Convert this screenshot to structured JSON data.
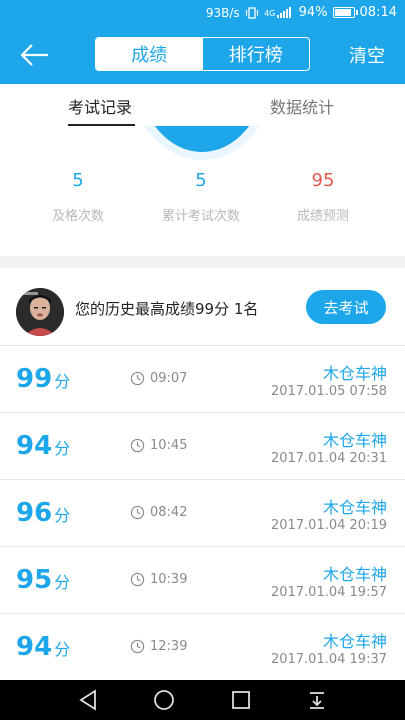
{
  "status_bar": {
    "net_speed": "93B/s",
    "battery": "94%",
    "time": "08:14"
  },
  "header": {
    "back_icon": "arrow-left-icon",
    "tabs": [
      "成绩",
      "排行榜"
    ],
    "active_tab": 0,
    "clear_label": "清空"
  },
  "subtabs": [
    "考试记录",
    "数据统计"
  ],
  "stats": [
    {
      "value": "5",
      "label": "及格次数",
      "color": "#1ea6ea"
    },
    {
      "value": "5",
      "label": "累计考试次数",
      "color": "#1ea6ea"
    },
    {
      "value": "95",
      "label": "成绩预测",
      "color": "#e8594d"
    }
  ],
  "best": {
    "text": "您的历史最高成绩99分 1名",
    "button": "去考试"
  },
  "records": [
    {
      "score": "99",
      "unit": "分",
      "duration": "09:07",
      "user": "木仓车神",
      "date": "2017.01.05  07:58"
    },
    {
      "score": "94",
      "unit": "分",
      "duration": "10:45",
      "user": "木仓车神",
      "date": "2017.01.04  20:31"
    },
    {
      "score": "96",
      "unit": "分",
      "duration": "08:42",
      "user": "木仓车神",
      "date": "2017.01.04  20:19"
    },
    {
      "score": "95",
      "unit": "分",
      "duration": "10:39",
      "user": "木仓车神",
      "date": "2017.01.04  19:57"
    },
    {
      "score": "94",
      "unit": "分",
      "duration": "12:39",
      "user": "木仓车神",
      "date": "2017.01.04  19:37"
    }
  ],
  "colors": {
    "primary": "#1ea6ea",
    "accent_red": "#e8594d"
  }
}
